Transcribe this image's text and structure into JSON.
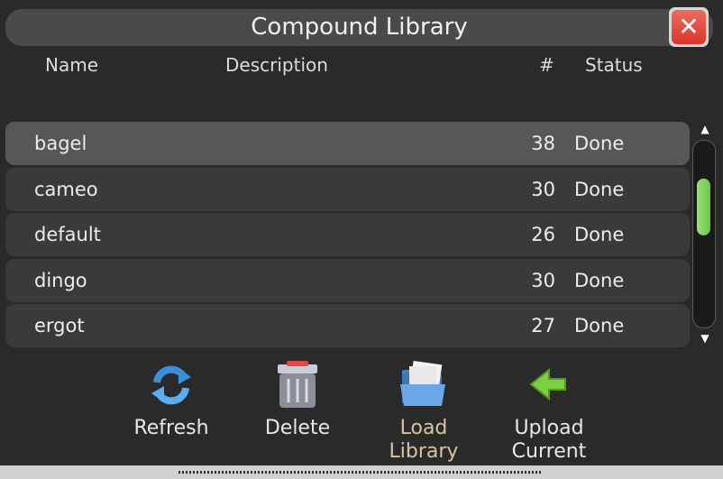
{
  "window": {
    "title": "Compound Library"
  },
  "columns": {
    "name": "Name",
    "description": "Description",
    "count": "#",
    "status": "Status"
  },
  "rows": [
    {
      "name": "bagel",
      "count": "38",
      "status": "Done",
      "selected": true
    },
    {
      "name": "cameo",
      "count": "30",
      "status": "Done"
    },
    {
      "name": "default",
      "count": "26",
      "status": "Done"
    },
    {
      "name": "dingo",
      "count": "30",
      "status": "Done"
    },
    {
      "name": "ergot",
      "count": "27",
      "status": "Done"
    }
  ],
  "toolbar": {
    "refresh_label": "Refresh",
    "delete_label": "Delete",
    "load_label": "Load Library",
    "upload_label": "Upload Current"
  },
  "colors": {
    "accent_green": "#6cc44a",
    "close_red": "#d9362a",
    "active_label": "#d8c4a0"
  },
  "icons": [
    "refresh-icon",
    "delete-icon",
    "folder-open-icon",
    "upload-arrow-icon",
    "close-icon"
  ]
}
